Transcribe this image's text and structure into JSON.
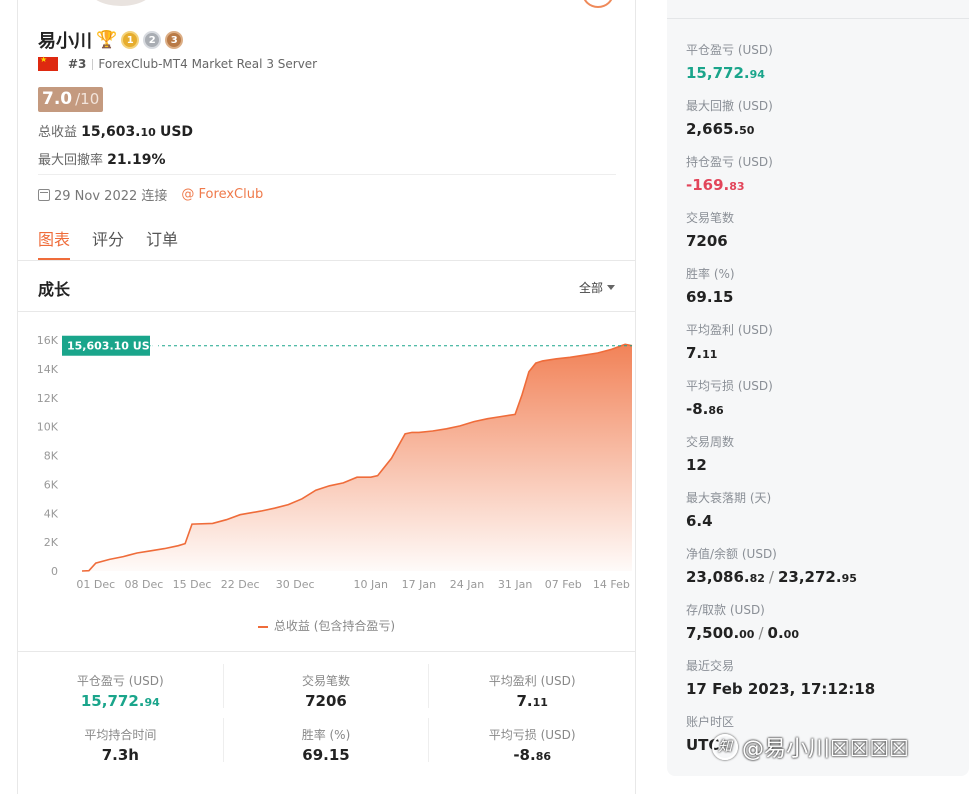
{
  "profile": {
    "name": "易小川",
    "rank": "#3",
    "server": "ForexClub-MT4 Market Real 3 Server",
    "score": "7.0",
    "score_max": "/10",
    "total_profit_label": "总收益",
    "total_profit_int": "15,603.",
    "total_profit_dec": "10",
    "total_profit_unit": "USD",
    "max_drawdown_label": "最大回撤率",
    "max_drawdown_value": "21.19%",
    "connected_date": "29 Nov 2022 连接",
    "broker": "@ ForexClub",
    "medals": [
      "1",
      "2",
      "3"
    ]
  },
  "tabs": [
    {
      "label": "图表",
      "active": true
    },
    {
      "label": "评分",
      "active": false
    },
    {
      "label": "订单",
      "active": false
    }
  ],
  "growth": {
    "title": "成长",
    "range_label": "全部",
    "legend": "总收益 (包含持合盈亏)"
  },
  "chart_data": {
    "type": "area",
    "current_label": "15,603.10 USD",
    "current_value": 15603.1,
    "y_ticks": [
      "0",
      "2K",
      "4K",
      "6K",
      "8K",
      "10K",
      "12K",
      "14K",
      "16K"
    ],
    "x_ticks": [
      "01 Dec",
      "08 Dec",
      "15 Dec",
      "22 Dec",
      "30 Dec",
      "10 Jan",
      "17 Jan",
      "24 Jan",
      "31 Jan",
      "07 Feb",
      "14 Feb"
    ],
    "ylim": [
      0,
      16000
    ],
    "x_start": "2022-11-29",
    "x_end": "2023-02-17",
    "x": [
      "2022-11-29",
      "2022-11-30",
      "2022-12-01",
      "2022-12-03",
      "2022-12-05",
      "2022-12-07",
      "2022-12-09",
      "2022-12-11",
      "2022-12-13",
      "2022-12-14",
      "2022-12-15",
      "2022-12-18",
      "2022-12-20",
      "2022-12-22",
      "2022-12-25",
      "2022-12-27",
      "2022-12-29",
      "2022-12-31",
      "2023-01-02",
      "2023-01-04",
      "2023-01-06",
      "2023-01-08",
      "2023-01-10",
      "2023-01-11",
      "2023-01-13",
      "2023-01-15",
      "2023-01-16",
      "2023-01-17",
      "2023-01-19",
      "2023-01-21",
      "2023-01-23",
      "2023-01-25",
      "2023-01-27",
      "2023-01-29",
      "2023-01-31",
      "2023-02-01",
      "2023-02-02",
      "2023-02-03",
      "2023-02-04",
      "2023-02-06",
      "2023-02-08",
      "2023-02-10",
      "2023-02-12",
      "2023-02-14",
      "2023-02-16",
      "2023-02-17"
    ],
    "values": [
      0,
      20,
      550,
      800,
      1000,
      1250,
      1400,
      1550,
      1750,
      1900,
      3250,
      3300,
      3550,
      3900,
      4150,
      4350,
      4600,
      5000,
      5600,
      5900,
      6100,
      6500,
      6500,
      6600,
      7800,
      9500,
      9600,
      9600,
      9700,
      9850,
      10050,
      10350,
      10550,
      10700,
      10850,
      12200,
      13800,
      14400,
      14550,
      14700,
      14800,
      14950,
      15100,
      15350,
      15700,
      15603
    ]
  },
  "stats": [
    {
      "label": "平仓盈亏 (USD)",
      "int": "15,772.",
      "dec": "94",
      "color": "green"
    },
    {
      "label": "交易笔数",
      "int": "7206",
      "dec": "",
      "color": ""
    },
    {
      "label": "平均盈利 (USD)",
      "int": "7.",
      "dec": "11",
      "color": ""
    },
    {
      "label": "平均持合时间",
      "int": "7.3h",
      "dec": "",
      "color": ""
    },
    {
      "label": "胜率 (%)",
      "int": "69.15",
      "dec": "",
      "color": ""
    },
    {
      "label": "平均亏损 (USD)",
      "int": "-8.",
      "dec": "86",
      "color": ""
    }
  ],
  "overview": [
    {
      "label": "平仓盈亏 (USD)",
      "int": "15,772.",
      "dec": "94",
      "color": "green"
    },
    {
      "label": "最大回撤 (USD)",
      "int": "2,665.",
      "dec": "50",
      "color": ""
    },
    {
      "label": "持仓盈亏 (USD)",
      "int": "-169.",
      "dec": "83",
      "color": "red"
    },
    {
      "label": "交易笔数",
      "int": "7206",
      "dec": "",
      "color": ""
    },
    {
      "label": "胜率 (%)",
      "int": "69.15",
      "dec": "",
      "color": ""
    },
    {
      "label": "平均盈利 (USD)",
      "int": "7.",
      "dec": "11",
      "color": ""
    },
    {
      "label": "平均亏损 (USD)",
      "int": "-8.",
      "dec": "86",
      "color": ""
    },
    {
      "label": "交易周数",
      "int": "12",
      "dec": "",
      "color": ""
    },
    {
      "label": "最大衰落期 (天)",
      "int": "6.4",
      "dec": "",
      "color": ""
    },
    {
      "label": "净值/余额 (USD)",
      "int": "23,086.",
      "dec": "82",
      "int2": "23,272.",
      "dec2": "95",
      "color": ""
    },
    {
      "label": "存/取款 (USD)",
      "int": "7,500.",
      "dec": "00",
      "int2": "0.",
      "dec2": "00",
      "color": ""
    },
    {
      "label": "最近交易",
      "int": "17 Feb 2023, 17:12:18",
      "dec": "",
      "color": ""
    },
    {
      "label": "账户时区",
      "int": "UTC",
      "dec": "",
      "color": ""
    }
  ],
  "watermark": {
    "icon": "知",
    "text": "@易小川☒☒☒☒"
  },
  "colors": {
    "accent": "#ef6c3a",
    "green": "#1aa58b",
    "red": "#e2455a",
    "badge": "#c49a7f"
  }
}
